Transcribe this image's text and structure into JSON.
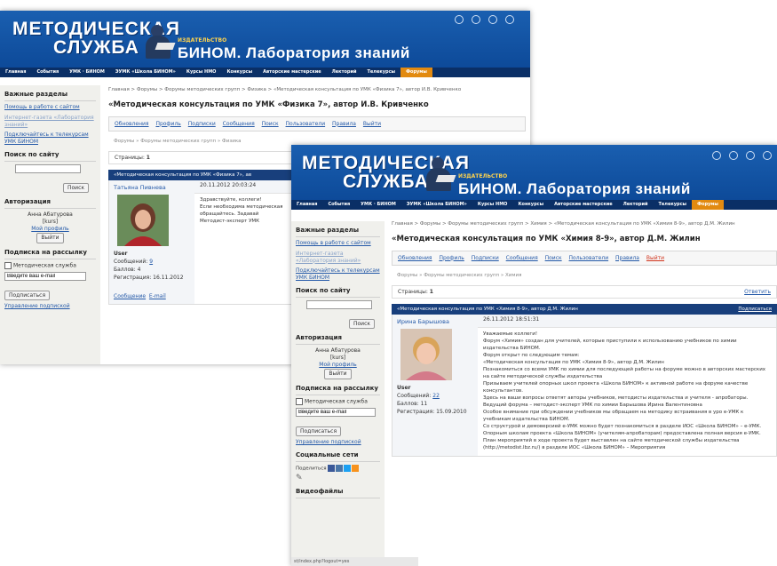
{
  "logo": {
    "line1": "МЕТОДИЧЕСКАЯ",
    "line2": "СЛУЖБА"
  },
  "publisher": {
    "label": "ИЗДАТЕЛЬСТВО",
    "brand": "БИНОМ. Лаборатория знаний"
  },
  "nav": [
    "Главная",
    "События",
    "УМК · БИНОМ",
    "ЭУМК «Школа БИНОМ»",
    "Курсы НМО",
    "Конкурсы",
    "Авторские мастерские",
    "Лекторий",
    "Телекурсы",
    "Форумы"
  ],
  "sidebar": {
    "sections_title": "Важные разделы",
    "links": [
      "Помощь в работе с сайтом",
      "Интернет-газета «Лаборатория знаний»",
      "Подключайтесь к телекурсам УМК БИНОМ"
    ],
    "search_title": "Поиск по сайту",
    "search_button": "Поиск",
    "auth_title": "Авторизация",
    "user_name": "Анна Абатурова",
    "user_login": "[kurs]",
    "profile_link": "Мой профиль",
    "logout_button": "Выйти",
    "subscribe_title": "Подписка на рассылку",
    "subscribe_option": "Методическая служба",
    "email_placeholder": "Введите ваш e-mail",
    "subscribe_button": "Подписаться",
    "manage_link": "Управление подпиской",
    "social_title": "Социальные сети",
    "share_label": "Поделиться",
    "video_title": "Видеофайлы"
  },
  "forum_tabs": [
    "Обновления",
    "Профиль",
    "Подписки",
    "Сообщения",
    "Поиск",
    "Пользователи",
    "Правила",
    "Выйти"
  ],
  "pages_label": "Страницы:",
  "page_num": "1",
  "win1": {
    "breadcrumb": "Главная > Форумы > Форумы методических групп > Физика > «Методическая консультация по УМК «Физика 7», автор И.В. Кривченко",
    "title": "«Методическая консультация по УМК «Физика 7», автор И.В. Кривченко",
    "subnav": "Форумы » Форумы методических групп » Физика",
    "thread_bar": "«Методическая консультация по УМК «Физика 7», ав",
    "author": "Татьяна Пивнева",
    "date": "20.11.2012 20:03:24",
    "role": "User",
    "posts_label": "Сообщений:",
    "posts": "9",
    "points": "Баллов: 4",
    "reg": "Регистрация: 16.11.2012",
    "msg_link": "Сообщение",
    "email_link": "E-mail",
    "text": [
      "Здравствуйте, коллеги!",
      "Если необходима методическая",
      "обращайтесь. Задавай",
      "Методист-эксперт УМК"
    ]
  },
  "win2": {
    "breadcrumb": "Главная > Форумы > Форумы методических групп > Химия > «Методическая консультация по УМК «Химия 8-9», автор Д.М. Жилин",
    "title": "«Методическая консультация по УМК «Химия 8-9», автор Д.М. Жилин",
    "subnav": "Форумы » Форумы методических групп » Химия",
    "thread_bar": "«Методическая консультация по УМК «Химия 8-9», автор Д.М. Жилин",
    "reply": "Ответить",
    "subscribe": "Подписаться",
    "author": "Ирина Барышова",
    "date": "26.11.2012 18:51:31",
    "role": "User",
    "posts_label": "Сообщений:",
    "posts": "22",
    "points": "Баллов: 11",
    "reg": "Регистрация: 15.09.2010",
    "text": [
      "Уважаемые коллеги!",
      "Форум «Химия» создан для учителей, которые приступили к использованию учебников по химии издательства БИНОМ.",
      "Форум открыт по следующим темам:",
      "«Методическая консультация по УМК «Химия 8-9», автор Д.М. Жилин",
      "Познакомиться со всеми УМК по химии для последующей работы на форуме можно в авторских мастерских на сайте методической службы издательства",
      "Призываем учителей опорных школ проекта «Школа БИНОМ» к активной работе на форуме качестве консультантов.",
      "Здесь на ваши вопросы ответят авторы учебников, методисты издательства и учителя - апробаторы.",
      "Ведущий форума – методист-эксперт УМК по химии Барышова Ирина Валентиновна",
      "Особое внимание при обсуждении учебников мы обращаем на методику встраивания в уро е-УМК к учебникам издательства БИНОМ.",
      "Со структурой и демоверсией е-УМК можно будет познакомиться в разделе ИОС «Школа БИНОМ» – е-УМК. Опорным школам проекта «Школа БИНОМ» (учителям-апробаторам) предоставлена полная версия е-УМК.",
      "План мероприятий в ходе проекта будет выставлен на сайте методической службы издательства (http://metodist.lbz.ru/) в разделе ИОС «Школа БИНОМ» – Мероприятия"
    ],
    "status": "st/index.php?logout=yes"
  }
}
